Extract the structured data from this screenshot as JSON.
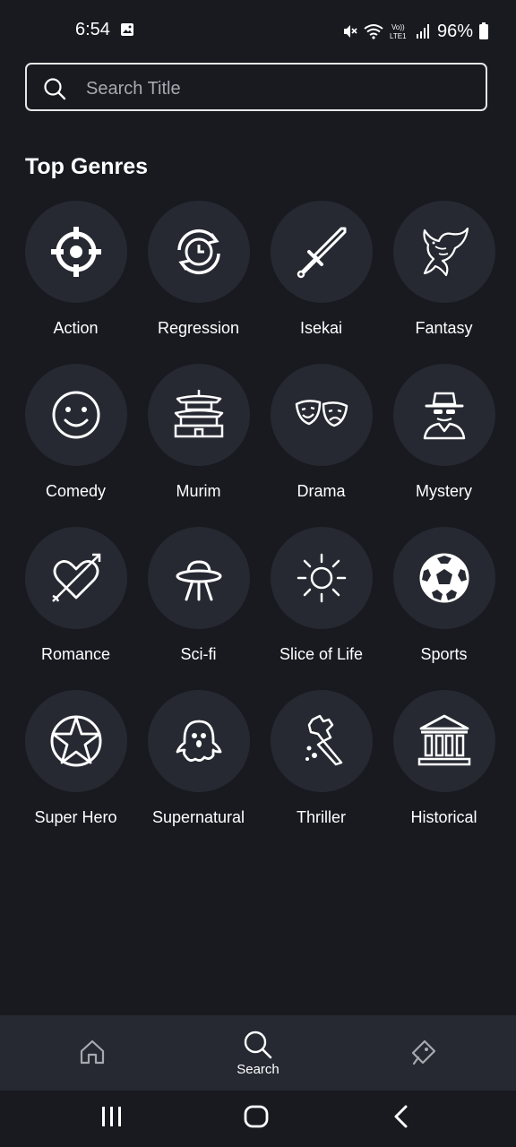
{
  "status_bar": {
    "time": "6:54",
    "battery": "96%",
    "network": "LTE1"
  },
  "search": {
    "placeholder": "Search Title",
    "value": ""
  },
  "section_title": "Top Genres",
  "genres": [
    {
      "label": "Action",
      "icon": "crosshair-icon"
    },
    {
      "label": "Regression",
      "icon": "time-rewind-icon"
    },
    {
      "label": "Isekai",
      "icon": "sword-icon"
    },
    {
      "label": "Fantasy",
      "icon": "dragon-icon"
    },
    {
      "label": "Comedy",
      "icon": "smiley-icon"
    },
    {
      "label": "Murim",
      "icon": "pagoda-icon"
    },
    {
      "label": "Drama",
      "icon": "theater-masks-icon"
    },
    {
      "label": "Mystery",
      "icon": "detective-icon"
    },
    {
      "label": "Romance",
      "icon": "heart-arrow-icon"
    },
    {
      "label": "Sci-fi",
      "icon": "ufo-icon"
    },
    {
      "label": "Slice of Life",
      "icon": "sun-icon"
    },
    {
      "label": "Sports",
      "icon": "soccer-ball-icon"
    },
    {
      "label": "Super Hero",
      "icon": "star-badge-icon"
    },
    {
      "label": "Supernatural",
      "icon": "ghost-icon"
    },
    {
      "label": "Thriller",
      "icon": "knife-hand-icon"
    },
    {
      "label": "Historical",
      "icon": "museum-icon"
    }
  ],
  "bottom_nav": {
    "home_label": "",
    "search_label": "Search",
    "tag_label": ""
  },
  "colors": {
    "background": "#181a20",
    "surface": "#262932",
    "text": "#ffffff",
    "placeholder": "#a7a9b0"
  }
}
